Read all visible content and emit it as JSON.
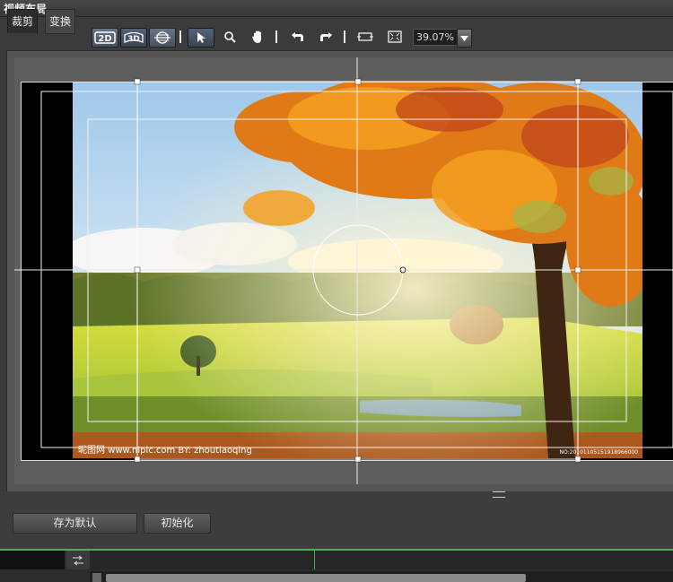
{
  "window": {
    "title": "视频布局"
  },
  "tabs": [
    {
      "label": "裁剪",
      "active": true
    },
    {
      "label": "变换",
      "active": false
    }
  ],
  "toolbar": {
    "zoom_value": "39.07%",
    "buttons": [
      {
        "name": "2d-mode-button",
        "label": "2D"
      },
      {
        "name": "3d-mode-button",
        "label": "3D"
      },
      {
        "name": "sphere-mode-button",
        "label": ""
      },
      {
        "name": "select-tool-button",
        "label": ""
      },
      {
        "name": "zoom-tool-button",
        "label": ""
      },
      {
        "name": "hand-tool-button",
        "label": ""
      },
      {
        "name": "undo-button",
        "label": ""
      },
      {
        "name": "redo-button",
        "label": ""
      },
      {
        "name": "fit-window-button",
        "label": ""
      },
      {
        "name": "fullscreen-button",
        "label": ""
      }
    ]
  },
  "preview": {
    "watermark_left": "昵图网 www.nipic.com   BY: zhoutiaoqing",
    "watermark_right": "NO:20101105151918966000"
  },
  "actions": {
    "save_default_label": "存为默认",
    "initialize_label": "初始化"
  },
  "colors": {
    "accent_green": "#4caf50",
    "panel_bg": "#3a3a3a",
    "viewport_bg": "#5d5d5d"
  }
}
